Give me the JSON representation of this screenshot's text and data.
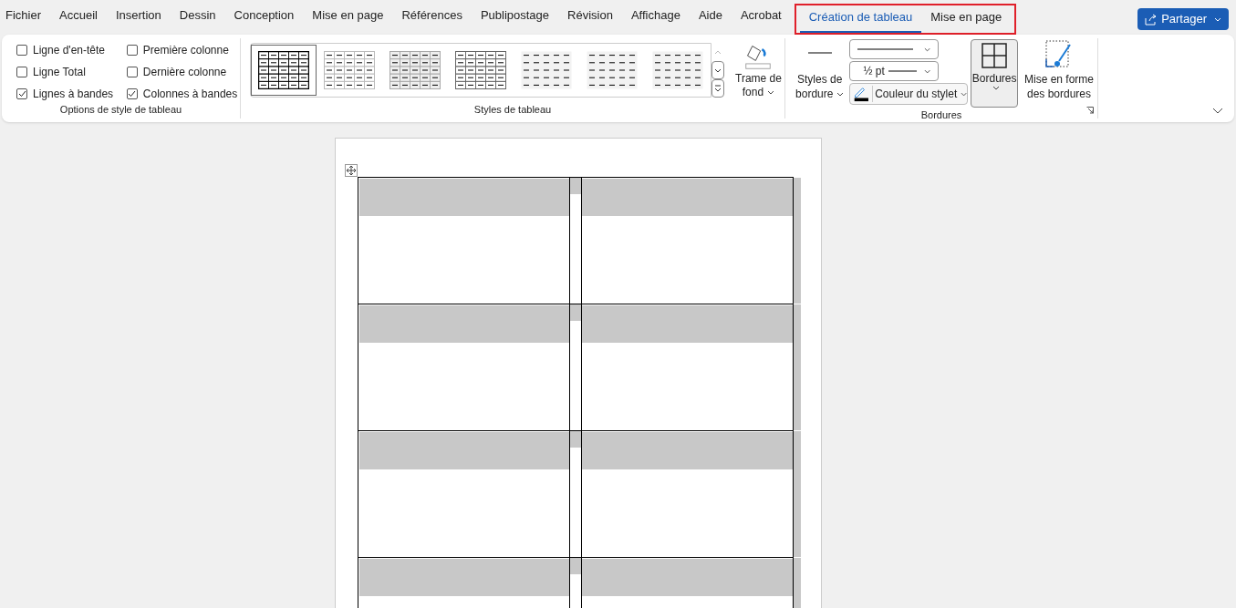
{
  "menu_tabs": [
    {
      "label": "Fichier",
      "selected": false
    },
    {
      "label": "Accueil",
      "selected": false
    },
    {
      "label": "Insertion",
      "selected": false
    },
    {
      "label": "Dessin",
      "selected": false
    },
    {
      "label": "Conception",
      "selected": false
    },
    {
      "label": "Mise en page",
      "selected": false
    },
    {
      "label": "Références",
      "selected": false
    },
    {
      "label": "Publipostage",
      "selected": false
    },
    {
      "label": "Révision",
      "selected": false
    },
    {
      "label": "Affichage",
      "selected": false
    },
    {
      "label": "Aide",
      "selected": false
    },
    {
      "label": "Acrobat",
      "selected": false
    }
  ],
  "contextual_tabs": {
    "outlined": true,
    "items": [
      {
        "label": "Création de tableau",
        "selected": true
      },
      {
        "label": "Mise en page",
        "selected": false
      }
    ]
  },
  "share_button": {
    "label": "Partager"
  },
  "style_options": {
    "title": "Options de style de tableau",
    "checkboxes": [
      {
        "label": "Ligne d'en-tête",
        "checked": false
      },
      {
        "label": "Ligne Total",
        "checked": false
      },
      {
        "label": "Lignes à bandes",
        "checked": true
      },
      {
        "label": "Première colonne",
        "checked": false
      },
      {
        "label": "Dernière colonne",
        "checked": false
      },
      {
        "label": "Colonnes à bandes",
        "checked": true
      }
    ]
  },
  "table_styles": {
    "title": "Styles de tableau",
    "styles": [
      {
        "kind": "grid",
        "selected": true
      },
      {
        "kind": "light",
        "selected": false
      },
      {
        "kind": "banded",
        "selected": false
      },
      {
        "kind": "medium",
        "selected": false
      },
      {
        "kind": "plain",
        "selected": false
      },
      {
        "kind": "plain",
        "selected": false
      },
      {
        "kind": "plain",
        "selected": false
      }
    ],
    "shading": {
      "line1": "Trame de",
      "line2": "fond"
    }
  },
  "borders": {
    "title": "Bordures",
    "border_styles": {
      "line1": "Styles de",
      "line2": "bordure"
    },
    "weight": "½ pt",
    "pen_color": "Couleur du stylet",
    "borders_button": "Bordures",
    "painter": {
      "line1": "Mise en forme",
      "line2": "des bordures"
    }
  }
}
